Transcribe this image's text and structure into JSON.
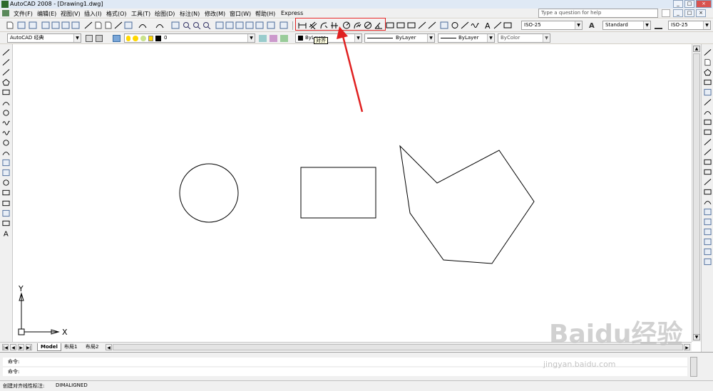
{
  "window": {
    "title": "AutoCAD 2008 - [Drawing1.dwg]"
  },
  "menu": {
    "items": [
      "文件(F)",
      "编辑(E)",
      "视图(V)",
      "插入(I)",
      "格式(O)",
      "工具(T)",
      "绘图(D)",
      "标注(N)",
      "修改(M)",
      "窗口(W)",
      "帮助(H)",
      "Express"
    ],
    "help_placeholder": "Type a question for help"
  },
  "toolbar": {
    "text_style": "ISO-25",
    "dim_style": "Standard",
    "table_style": "ISO-25",
    "workspace": "AutoCAD 经典",
    "layer": "0",
    "color": "ByLayer",
    "linetype": "ByLayer",
    "lineweight": "ByLayer",
    "plotstyle": "ByColor"
  },
  "tooltip": "对齐",
  "layout_tabs": [
    "Model",
    "布局1",
    "布局2"
  ],
  "command": {
    "line1": "命令:",
    "line2": "命令:"
  },
  "status": {
    "text": "创建对齐线性标注:",
    "command": "DIMALIGNED"
  },
  "ucs": {
    "x_label": "X",
    "y_label": "Y"
  },
  "watermark": {
    "brand": "Baidu经验",
    "url": "jingyan.baidu.com"
  },
  "colors": {
    "highlight_box": "#e02020",
    "arrow": "#e02020"
  },
  "icons": [
    "dim-linear-icon",
    "dim-aligned-icon",
    "dim-arc-icon",
    "dim-ordinate-icon",
    "dim-radius-icon",
    "dim-jogged-icon",
    "dim-diameter-icon",
    "dim-angular-icon"
  ]
}
